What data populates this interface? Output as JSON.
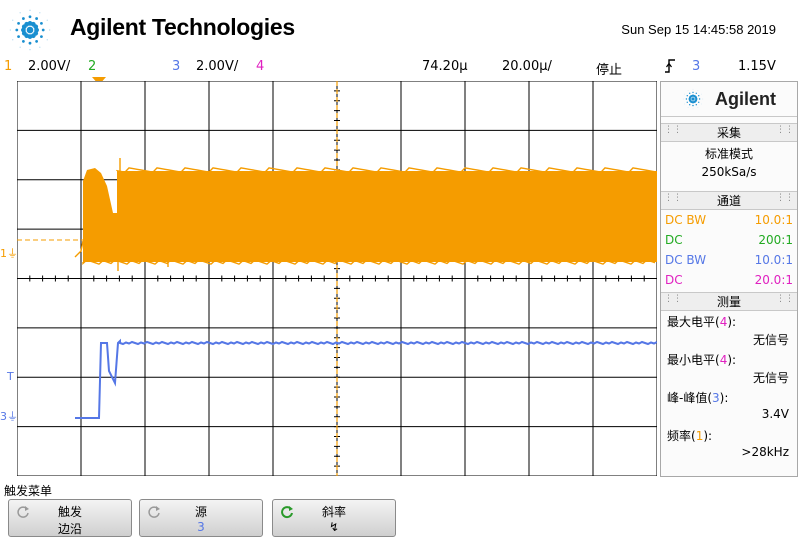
{
  "header": {
    "brand": "Agilent Technologies",
    "datetime": "Sun Sep 15 14:45:58 2019"
  },
  "status": {
    "ch1_num": "1",
    "ch1_scale": "2.00V/",
    "ch2_num": "2",
    "ch3_num": "3",
    "ch3_scale": "2.00V/",
    "ch4_num": "4",
    "time_delay": "74.20µ",
    "time_scale": "20.00µ/",
    "run_state": "停止",
    "trig_slope_icon": "rising-edge-icon",
    "trig_source": "3",
    "trig_level": "1.15V"
  },
  "plot": {
    "ch1_marker": "1",
    "ch3_marker": "3",
    "trig_marker": "T"
  },
  "panel": {
    "brand": "Agilent",
    "acq_title": "采集",
    "acq_mode": "标准模式",
    "acq_rate": "250kSa/s",
    "chan_title": "通道",
    "channels": [
      {
        "coupling": "DC BW",
        "probe": "10.0:1",
        "color": "#f59c00"
      },
      {
        "coupling": "DC",
        "probe": "200:1",
        "color": "#22aa22"
      },
      {
        "coupling": "DC BW",
        "probe": "10.0:1",
        "color": "#5577e6"
      },
      {
        "coupling": "DC",
        "probe": "20.0:1",
        "color": "#e020c0"
      }
    ],
    "meas_title": "测量",
    "measurements": [
      {
        "label": "最大电平",
        "ch": "4",
        "value": "无信号",
        "ch_color": "#e020c0"
      },
      {
        "label": "最小电平",
        "ch": "4",
        "value": "无信号",
        "ch_color": "#e020c0"
      },
      {
        "label": "峰-峰值",
        "ch": "3",
        "value": "3.4V",
        "ch_color": "#5577e6"
      },
      {
        "label": "频率",
        "ch": "1",
        "value": ">28kHz",
        "ch_color": "#f59c00"
      }
    ]
  },
  "softkeys": {
    "menu_title": "触发菜单",
    "keys": [
      {
        "title": "触发",
        "value": "边沿"
      },
      {
        "title": "源",
        "value": "3"
      },
      {
        "title": "斜率",
        "value": "↯"
      }
    ]
  },
  "colors": {
    "ch1": "#f59c00",
    "ch2": "#22aa22",
    "ch3": "#5577e6",
    "ch4": "#e020c0",
    "grid": "#000000"
  }
}
